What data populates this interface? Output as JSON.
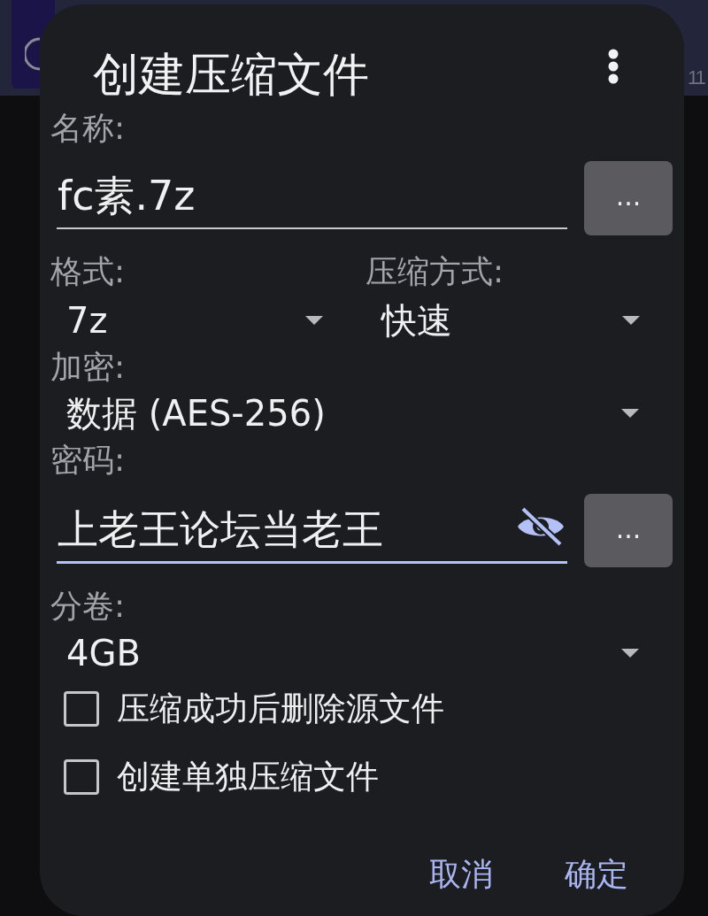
{
  "background": {
    "counter": "11"
  },
  "dialog": {
    "title": "创建压缩文件",
    "name": {
      "label": "名称:",
      "value": "fc素.7z",
      "focused": false,
      "button": "..."
    },
    "format": {
      "label": "格式:",
      "value": "7z"
    },
    "compression": {
      "label": "压缩方式:",
      "value": "快速"
    },
    "encryption": {
      "label": "加密:",
      "value": "数据 (AES-256)"
    },
    "password": {
      "label": "密码:",
      "value": "上老王论坛当老王",
      "focused": true,
      "visible": true,
      "button": "..."
    },
    "split": {
      "label": "分卷:",
      "value": "4GB"
    },
    "options": [
      {
        "label": "压缩成功后删除源文件",
        "checked": false
      },
      {
        "label": "创建单独压缩文件",
        "checked": false
      }
    ],
    "buttons": [
      "取消",
      "确定"
    ]
  }
}
